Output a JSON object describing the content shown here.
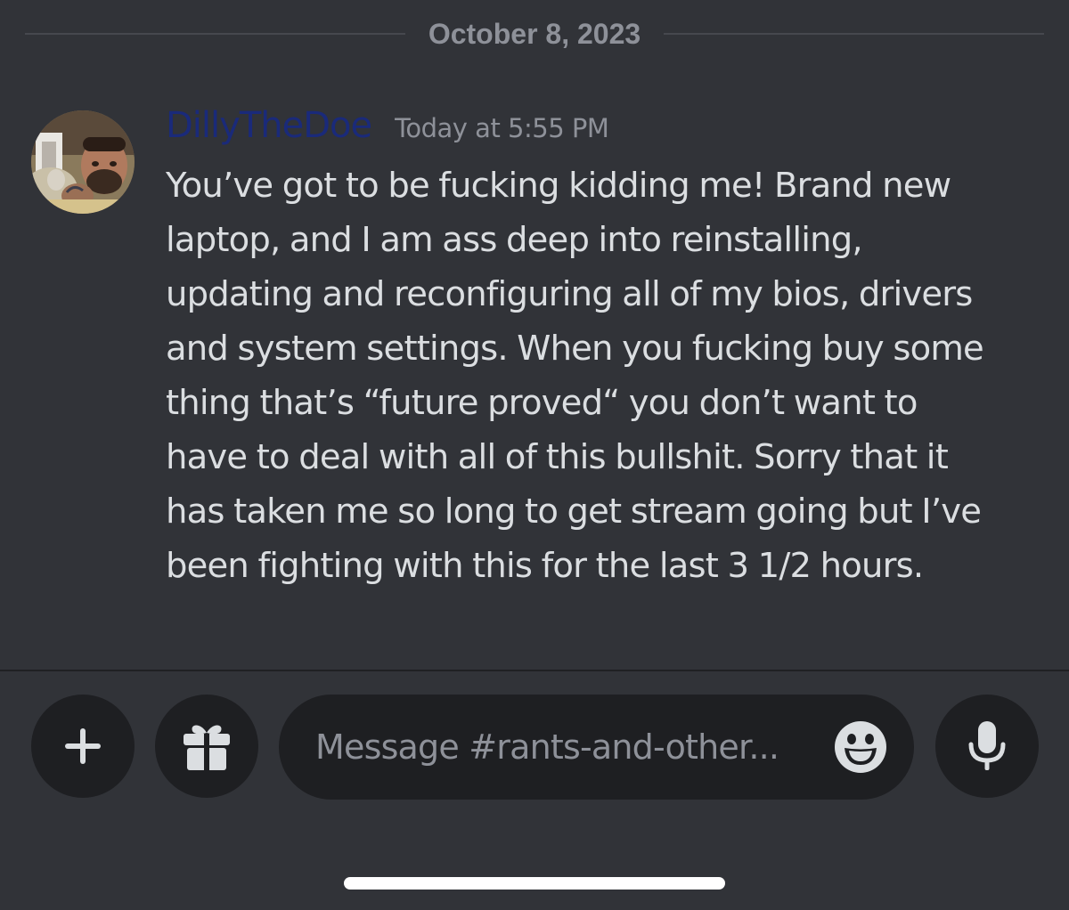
{
  "date_divider": {
    "label": "October 8, 2023"
  },
  "message": {
    "username": "DillyTheDoe",
    "username_color": "#1a2a7a",
    "timestamp": "Today at 5:55 PM",
    "lines": [
      "You’ve got to be fucking kidding me! Brand new",
      "laptop, and I am ass deep into reinstalling,",
      "updating and reconfiguring all of my bios, drivers",
      "and system settings. When you fucking buy some",
      "thing that’s “future proved“ you don’t want to",
      "have to deal with all of this bullshit. Sorry that it",
      "has taken me so long to get stream going but I’ve",
      "been fighting with this for the last 3 1/2 hours."
    ],
    "avatar": "user-avatar-photo"
  },
  "composer": {
    "placeholder": "Message #rants-and-other...",
    "buttons": {
      "plus": "plus-icon",
      "gift": "gift-icon",
      "emoji": "emoji-smile-icon",
      "mic": "microphone-icon"
    }
  },
  "colors": {
    "background": "#313338",
    "input_background": "#1e1f22",
    "muted_text": "#8e9199",
    "message_text": "#dbdee1"
  }
}
